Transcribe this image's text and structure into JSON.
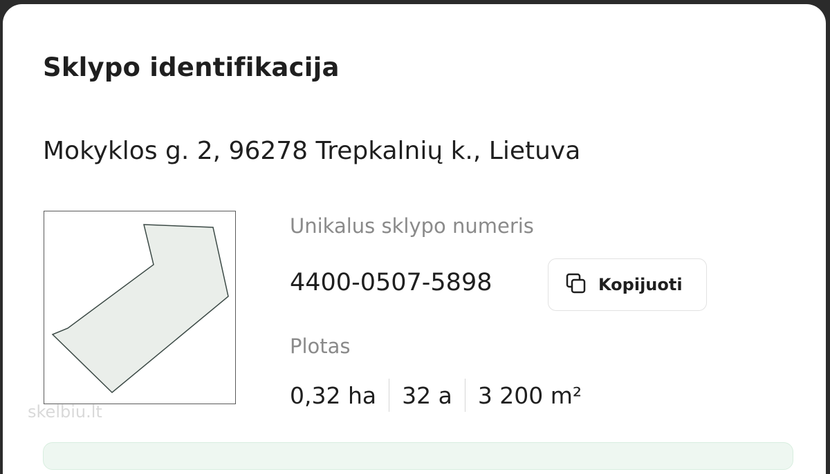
{
  "panel": {
    "title": "Sklypo identifikacija",
    "address": "Mokyklos g. 2, 96278 Trepkalnių k., Lietuva"
  },
  "parcel": {
    "number_label": "Unikalus sklypo numeris",
    "number_value": "4400-0507-5898",
    "copy_button_label": "Kopijuoti",
    "area_label": "Plotas",
    "area_ha": "0,32 ha",
    "area_a": "32 a",
    "area_m2": "3 200 m²"
  },
  "watermark": "skelbiu.lt",
  "colors": {
    "parcel_fill": "#eaeeea",
    "text_primary": "#1f1f1f",
    "text_secondary": "#8a8a8a"
  }
}
